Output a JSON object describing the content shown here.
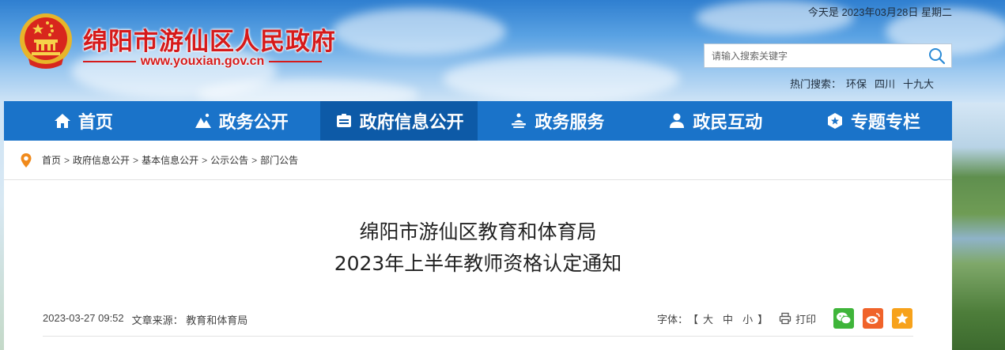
{
  "header": {
    "site_name": "绵阳市游仙区人民政府",
    "site_url": "www.youxian.gov.cn",
    "date_text": "今天是 2023年03月28日 星期二",
    "search": {
      "placeholder": "请输入搜索关键字"
    },
    "hot_search": {
      "label": "热门搜索：",
      "terms": [
        "环保",
        "四川",
        "十九大"
      ]
    }
  },
  "nav": {
    "items": [
      {
        "label": "首页",
        "icon": "home-icon"
      },
      {
        "label": "政务公开",
        "icon": "mountain-icon"
      },
      {
        "label": "政府信息公开",
        "icon": "id-card-icon",
        "active": true
      },
      {
        "label": "政务服务",
        "icon": "service-icon"
      },
      {
        "label": "政民互动",
        "icon": "people-icon"
      },
      {
        "label": "专题专栏",
        "icon": "badge-icon"
      }
    ]
  },
  "breadcrumb": [
    "首页",
    "政府信息公开",
    "基本信息公开",
    "公示公告",
    "部门公告"
  ],
  "breadcrumb_separator": ">",
  "article": {
    "title_line1": "绵阳市游仙区教育和体育局",
    "title_line2": "2023年上半年教师资格认定通知",
    "datetime": "2023-03-27 09:52",
    "source_label": "文章来源：",
    "source": "教育和体育局",
    "font_label": "字体：",
    "font_open": "【",
    "font_large": "大",
    "font_medium": "中",
    "font_small": "小",
    "font_close": "】",
    "print_label": "打印"
  },
  "colors": {
    "brand_red": "#d61a1a",
    "nav_blue": "#1a73c9",
    "nav_active": "#0d5aa7",
    "wechat": "#3fb53a",
    "weibo": "#f0632a",
    "favorite": "#f7a21b"
  }
}
